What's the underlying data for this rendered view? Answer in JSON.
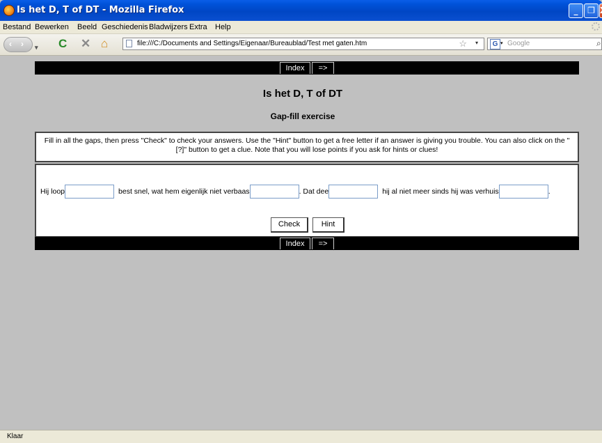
{
  "window": {
    "title": "Is het D, T of DT - Mozilla Firefox",
    "min_glyph": "_",
    "max_glyph": "❐",
    "close_glyph": "X"
  },
  "menu": [
    "Bestand",
    "Bewerken",
    "Beeld",
    "Geschiedenis",
    "Bladwijzers",
    "Extra",
    "Help"
  ],
  "toolbar": {
    "url": "file:///C:/Documents and Settings/Eigenaar/Bureaublad/Test met gaten.htm",
    "search_placeholder": "Google",
    "back_glyph": "‹",
    "forward_glyph": "›",
    "reload_glyph": "C",
    "stop_glyph": "✕",
    "home_glyph": "⌂",
    "bookmark_glyph": "☆",
    "dropdown_glyph": "▾",
    "search_engine_letter": "G",
    "search_glyph": "⌕"
  },
  "page": {
    "nav_index": "Index",
    "nav_next": "=>",
    "title": "Is het D, T of DT",
    "subtitle": "Gap-fill exercise",
    "instructions": "Fill in all the gaps, then press \"Check\" to check your answers. Use the \"Hint\" button to get a free letter if an answer is giving you trouble. You can also click on the \"[?]\" button to get a clue. Note that you will lose points if you ask for hints or clues!",
    "sentence": {
      "part1": "Hij loop",
      "part2": "best snel, wat hem eigenlijk niet verbaas",
      "part3": ". Dat dee",
      "part4": "hij al niet meer sinds hij was verhuis",
      "part5": "."
    },
    "gaps": [
      "",
      "",
      "",
      ""
    ],
    "check_label": "Check",
    "hint_label": "Hint"
  },
  "status": {
    "text": "Klaar"
  },
  "colors": {
    "titlebar": "#0052d9",
    "page_background": "#c0c0c0",
    "nav_bar": "#000000"
  }
}
